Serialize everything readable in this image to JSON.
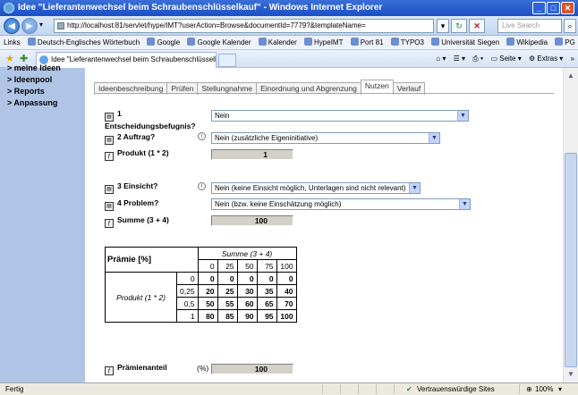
{
  "window": {
    "title": "Idee \"Lieferantenwechsel beim Schraubenschlüsselkauf\" - Windows Internet Explorer"
  },
  "nav": {
    "address": "http://localhost:81/servlet/hype/IMT?userAction=Browse&documentId=7779?&templateName=",
    "search_placeholder": "Live Search"
  },
  "links": {
    "label": "Links",
    "items": [
      "Deutsch-Englisches Wörterbuch",
      "Google",
      "Google Kalender",
      "Kalender",
      "HypeIMT",
      "Port 81",
      "TYPO3",
      "Universität Siegen",
      "Wikipedia",
      "PG"
    ]
  },
  "browser_tab": {
    "label": "Idee \"Lieferantenwechsel beim Schraubenschlüsselkauf\""
  },
  "commands": {
    "page": "Seite",
    "extras": "Extras"
  },
  "sidebar": {
    "items": [
      "> meine Ideen",
      "> Ideenpool",
      "> Reports",
      "> Anpassung"
    ]
  },
  "tabs": [
    "Ideenbeschreibung",
    "Prüfen",
    "Stellungnahme",
    "Einordnung und Abgrenzung",
    "Nutzen",
    "Verlauf"
  ],
  "form": {
    "q1_label": "1 Entscheidungsbefugnis?",
    "q1_value": "Nein",
    "q2_label": "2 Auftrag?",
    "q2_value": "Nein (zusätzliche Eigeninitiative)",
    "product_label": "Produkt (1 * 2)",
    "product_value": "1",
    "q3_label": "3 Einsicht?",
    "q3_value": "Nein (keine Einsicht möglich, Unterlagen sind nicht relevant)",
    "q4_label": "4 Problem?",
    "q4_value": "Nein (bzw. keine Einschätzung möglich)",
    "sum_label": "Summe (3 + 4)",
    "sum_value": "100",
    "bonus_label": "Prämienanteil",
    "bonus_unit": "(%)",
    "bonus_value": "100"
  },
  "table": {
    "title": "Prämie [%]",
    "col_header": "Summe (3 + 4)",
    "row_header": "Produkt (1 * 2)",
    "cols": [
      "0",
      "25",
      "50",
      "75",
      "100"
    ],
    "rows": [
      {
        "key": "0",
        "values": [
          "0",
          "0",
          "0",
          "0",
          "0"
        ]
      },
      {
        "key": "0,25",
        "values": [
          "20",
          "25",
          "30",
          "35",
          "40"
        ]
      },
      {
        "key": "0,5",
        "values": [
          "50",
          "55",
          "60",
          "65",
          "70"
        ]
      },
      {
        "key": "1",
        "values": [
          "80",
          "85",
          "90",
          "95",
          "100"
        ]
      }
    ]
  },
  "status": {
    "left": "Fertig",
    "zone": "Vertrauenswürdige Sites",
    "zoom": "100%"
  }
}
